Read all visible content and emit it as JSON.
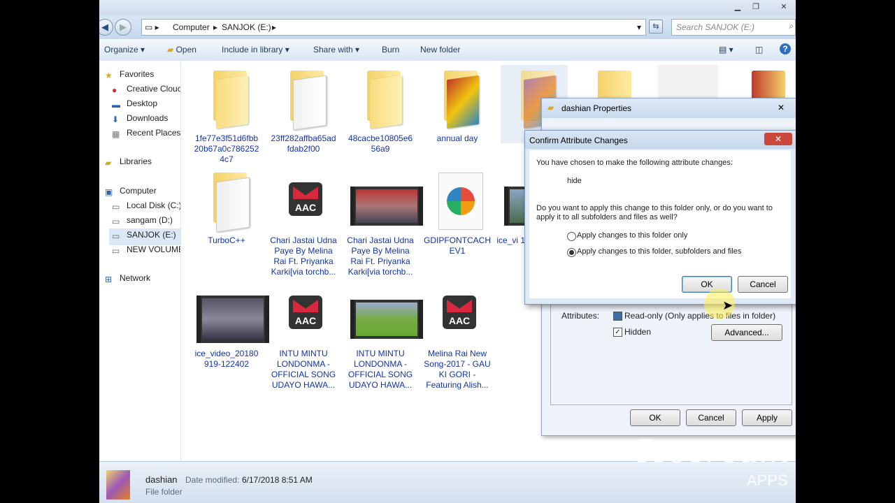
{
  "explorer": {
    "address": {
      "crumbs": [
        "Computer",
        "SANJOK (E:)"
      ]
    },
    "search_placeholder": "Search SANJOK (E:)",
    "toolbar": {
      "organize": "Organize",
      "open": "Open",
      "include_in_library": "Include in library",
      "share_with": "Share with",
      "burn": "Burn",
      "new_folder": "New folder"
    },
    "sidebar": {
      "favorites": "Favorites",
      "favorite_items": [
        "Creative Clouc",
        "Desktop",
        "Downloads",
        "Recent Places"
      ],
      "libraries": "Libraries",
      "computer": "Computer",
      "drives": [
        "Local Disk (C:)",
        "sangam (D:)",
        "SANJOK (E:)",
        "NEW VOLUME"
      ],
      "network": "Network"
    },
    "files": [
      {
        "name": "1fe77e3f51d6fbb20b67a0c7862524c7",
        "kind": "folder"
      },
      {
        "name": "23ff282affba65adfdab2f00",
        "kind": "folder"
      },
      {
        "name": "48cacbe10805e656a9",
        "kind": "folder"
      },
      {
        "name": "annual day",
        "kind": "folder"
      },
      {
        "name": "TurboC++",
        "kind": "folder"
      },
      {
        "name": "Chari Jastai Udna Paye By Melina Rai Ft. Priyanka Karki[via torchb...",
        "kind": "aac"
      },
      {
        "name": "Chari Jastai Udna Paye By Melina Rai Ft. Priyanka Karki[via torchb...",
        "kind": "video"
      },
      {
        "name": "GDIPFONTCACHEV1",
        "kind": "file"
      },
      {
        "name": "ice_vi 19",
        "kind": "video"
      },
      {
        "name": "ice_video_20180919-122402",
        "kind": "video"
      },
      {
        "name": "INTU MINTU LONDONMA - OFFICIAL SONG UDAYO HAWA...",
        "kind": "aac"
      },
      {
        "name": "INTU MINTU LONDONMA - OFFICIAL SONG UDAYO HAWA...",
        "kind": "video"
      },
      {
        "name": "Melina Rai New Song-2017 - GAU KI GORI - Featuring Alish...",
        "kind": "aac"
      }
    ],
    "status": {
      "name": "dashian",
      "date_label": "Date modified:",
      "date_value": "6/17/2018 8:51 AM",
      "type": "File folder"
    }
  },
  "properties_dialog": {
    "title": "dashian Properties",
    "attributes_label": "Attributes:",
    "readonly_label": "Read-only (Only applies to files in folder)",
    "hidden_label": "Hidden",
    "advanced_button": "Advanced...",
    "ok": "OK",
    "cancel": "Cancel",
    "apply": "Apply"
  },
  "confirm_dialog": {
    "title": "Confirm Attribute Changes",
    "line1": "You have chosen to make the following attribute changes:",
    "change": "hide",
    "question": "Do you want to apply this change to this folder only, or do you want to apply it to all subfolders and files as well?",
    "option1": "Apply changes to this folder only",
    "option2": "Apply changes to this folder, subfolders and files",
    "ok": "OK",
    "cancel": "Cancel"
  },
  "watermark": {
    "brand": "Icecream",
    "sub": "APPS"
  }
}
